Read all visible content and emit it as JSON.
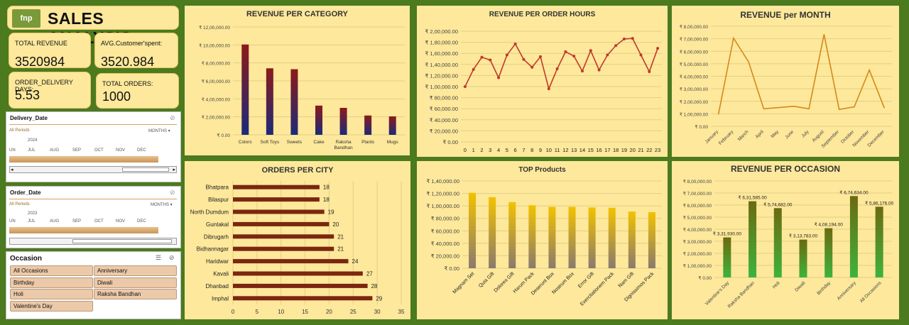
{
  "logo": "fnp",
  "title": "SALES ANALYSIS",
  "kpis": {
    "total_revenue_label": "TOTAL REVENUE",
    "total_revenue_value": "3520984",
    "avg_spent_label": "AVG.Customer'spent:",
    "avg_spent_value": "3520.984",
    "delivery_days_label": "ORDER_DELIVERY DAYS:",
    "delivery_days_value": "5.53",
    "total_orders_label": "TOTAL ORDERS:",
    "total_orders_value": "1000"
  },
  "slicers": {
    "delivery": {
      "title": "Delivery_Date",
      "periods": "All Periods",
      "unit": "MONTHS",
      "year": "2024",
      "months": [
        "UN",
        "JUL",
        "AUG",
        "SEP",
        "OCT",
        "NOV",
        "DEC"
      ]
    },
    "order": {
      "title": "Order_Date",
      "periods": "All Periods",
      "unit": "MONTHS",
      "year": "2023",
      "months": [
        "UN",
        "JUL",
        "AUG",
        "SEP",
        "OCT",
        "NOV",
        "DEC"
      ]
    },
    "occasion": {
      "title": "Occasion",
      "items": [
        "All Occasions",
        "Anniversary",
        "Birthday",
        "Diwali",
        "Holi",
        "Raksha Bandhan",
        "Valentine's Day"
      ]
    }
  },
  "chart_data": [
    {
      "type": "bar",
      "title": "REVENUE PER CATEGORY",
      "categories": [
        "Colors",
        "Soft Toys",
        "Sweets",
        "Cake",
        "Raksha Bandhan",
        "Plants",
        "Mugs"
      ],
      "values": [
        1005000,
        740000,
        730000,
        325000,
        300000,
        215000,
        205000
      ],
      "ylim": [
        0,
        1200000
      ],
      "yticks": [
        "₹ 0.00",
        "₹ 2,00,000.00",
        "₹ 4,00,000.00",
        "₹ 6,00,000.00",
        "₹ 8,00,000.00",
        "₹ 10,00,000.00",
        "₹ 12,00,000.00"
      ],
      "colors": [
        "#8b1a1a",
        "#1c2a7a"
      ]
    },
    {
      "type": "line",
      "title": "REVENUE PER ORDER HOURS",
      "x": [
        0,
        1,
        2,
        3,
        4,
        5,
        6,
        7,
        8,
        9,
        10,
        11,
        12,
        13,
        14,
        15,
        16,
        17,
        18,
        19,
        20,
        21,
        22,
        23
      ],
      "values": [
        100000,
        131000,
        153000,
        148000,
        116000,
        157000,
        177000,
        149000,
        135000,
        154000,
        96000,
        132000,
        163000,
        155000,
        128000,
        165000,
        130000,
        157000,
        174000,
        186000,
        187000,
        157000,
        127000,
        169000
      ],
      "ylim": [
        0,
        200000
      ],
      "yticks": [
        "₹ 0.00",
        "₹ 20,000.00",
        "₹ 40,000.00",
        "₹ 60,000.00",
        "₹ 80,000.00",
        "₹ 1,00,000.00",
        "₹ 1,20,000.00",
        "₹ 1,40,000.00",
        "₹ 1,60,000.00",
        "₹ 1,80,000.00",
        "₹ 2,00,000.00"
      ],
      "color": "#c0392b"
    },
    {
      "type": "line",
      "title": "REVENUE per MONTH",
      "categories": [
        "January",
        "February",
        "March",
        "April",
        "May",
        "June",
        "July",
        "August",
        "September",
        "October",
        "November",
        "December"
      ],
      "values": [
        95000,
        705000,
        515000,
        140000,
        150000,
        160000,
        140000,
        735000,
        135000,
        155000,
        450000,
        145000
      ],
      "ylim": [
        0,
        800000
      ],
      "yticks": [
        "₹ 0.00",
        "₹ 1,00,000.00",
        "₹ 2,00,000.00",
        "₹ 3,00,000.00",
        "₹ 4,00,000.00",
        "₹ 5,00,000.00",
        "₹ 6,00,000.00",
        "₹ 7,00,000.00",
        "₹ 8,00,000.00"
      ],
      "color": "#d4891c"
    },
    {
      "type": "bar",
      "title": "ORDERS PER CITY",
      "orientation": "horizontal",
      "categories": [
        "Bhatpara",
        "Bilaspur",
        "North Dumdum",
        "Guntakal",
        "Dibrugarh",
        "Bidhannagar",
        "Haridwar",
        "Kavali",
        "Dhanbad",
        "Imphal"
      ],
      "values": [
        18,
        18,
        19,
        20,
        21,
        21,
        24,
        27,
        28,
        29
      ],
      "xlim": [
        0,
        35
      ],
      "xticks": [
        "0",
        "5",
        "10",
        "15",
        "20",
        "25",
        "30",
        "35"
      ],
      "color": "#7b2710"
    },
    {
      "type": "bar",
      "title": "TOP Products",
      "categories": [
        "Magnam Set",
        "Quia Gift",
        "Dolores Gift",
        "Harum Pack",
        "Deserunt Box",
        "Nostrum Box",
        "Error Gift",
        "Exercitationem Pack",
        "Nam Gift",
        "Dignissimos Pack"
      ],
      "values": [
        121000,
        114000,
        106000,
        101000,
        98500,
        98500,
        97500,
        97000,
        91000,
        90000
      ],
      "ylim": [
        0,
        140000
      ],
      "yticks": [
        "₹ 0.00",
        "₹ 20,000.00",
        "₹ 40,000.00",
        "₹ 60,000.00",
        "₹ 80,000.00",
        "₹ 1,00,000.00",
        "₹ 1,20,000.00",
        "₹ 1,40,000.00"
      ],
      "colors": [
        "#f2c200",
        "#8a7a6e"
      ]
    },
    {
      "type": "bar",
      "title": "REVENUE PER OCCASION",
      "categories": [
        "Valentine's Day",
        "Raksha Bandhan",
        "Holi",
        "Diwali",
        "Birthday",
        "Anniversary",
        "All Occasions"
      ],
      "values": [
        331930,
        631585,
        574682,
        313783,
        408194,
        674634,
        586176
      ],
      "data_labels": [
        "₹ 3,31,930.00",
        "₹ 6,31,585.00",
        "₹ 5,74,682.00",
        "₹ 3,13,783.00",
        "₹ 4,08,194.00",
        "₹ 6,74,634.00",
        "₹ 5,86,176.00"
      ],
      "ylim": [
        0,
        800000
      ],
      "yticks": [
        "₹ 0.00",
        "₹ 1,00,000.00",
        "₹ 2,00,000.00",
        "₹ 3,00,000.00",
        "₹ 4,00,000.00",
        "₹ 5,00,000.00",
        "₹ 6,00,000.00",
        "₹ 7,00,000.00",
        "₹ 8,00,000.00"
      ],
      "colors": [
        "#6b6a10",
        "#3db33d"
      ]
    }
  ]
}
